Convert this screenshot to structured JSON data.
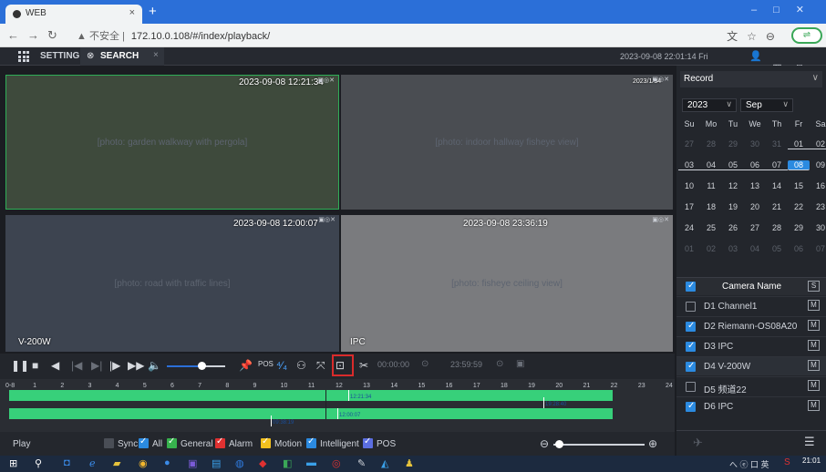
{
  "browser": {
    "tab_title": "WEB",
    "tab_close": "×",
    "new_tab": "+",
    "url_prefix": "▲ 不安全 |",
    "url": "172.10.0.108/#/index/playback/"
  },
  "app": {
    "setting_label": "SETTING",
    "search_label": "SEARCH",
    "tab_close": "×",
    "datetime": "2023-09-08 22:01:14 Fri"
  },
  "tiles": [
    {
      "timestamp": "2023-09-08 12:21:34",
      "label": "",
      "placeholder": "[photo: garden walkway with pergola]"
    },
    {
      "timestamp": "2023/1/34",
      "label": "",
      "placeholder": "[photo: indoor hallway fisheye view]"
    },
    {
      "timestamp": "2023-09-08 12:00:07",
      "label": "V-200W",
      "placeholder": "[photo: road with traffic lines]"
    },
    {
      "timestamp": "2023-09-08 23:36:19",
      "label": "IPC",
      "placeholder": "[photo: fisheye ceiling view]"
    }
  ],
  "toolbar": {
    "time_start": "00:00:00",
    "time_end": "23:59:59",
    "pos_label": "POS"
  },
  "timeline": {
    "ticks": [
      "0-8",
      "1",
      "2",
      "3",
      "4",
      "5",
      "6",
      "7",
      "8",
      "9",
      "10",
      "11",
      "12",
      "13",
      "14",
      "15",
      "16",
      "17",
      "18",
      "19",
      "20",
      "21",
      "22",
      "23",
      "24"
    ],
    "cursor_labels": [
      "12:21:34",
      "19:28:40",
      "12:00:07",
      "09:38:19"
    ]
  },
  "bottom": {
    "play_label": "Play",
    "filters": [
      {
        "label": "Sync",
        "checked": false,
        "color": "#4a4e56"
      },
      {
        "label": "All",
        "checked": true,
        "color": "#2b8ae0"
      },
      {
        "label": "General",
        "checked": true,
        "color": "#37b24d"
      },
      {
        "label": "Alarm",
        "checked": true,
        "color": "#e03131"
      },
      {
        "label": "Motion",
        "checked": true,
        "color": "#f2c01e"
      },
      {
        "label": "Intelligent",
        "checked": true,
        "color": "#2b8ae0"
      },
      {
        "label": "POS",
        "checked": true,
        "color": "#5b6ee1"
      }
    ]
  },
  "panel": {
    "record_type": "Record",
    "year": "2023",
    "month": "Sep",
    "weekdays": [
      "Su",
      "Mo",
      "Tu",
      "We",
      "Th",
      "Fr",
      "Sa"
    ],
    "weeks": [
      [
        "27",
        "28",
        "29",
        "30",
        "31",
        "01",
        "02"
      ],
      [
        "03",
        "04",
        "05",
        "06",
        "07",
        "08",
        "09"
      ],
      [
        "10",
        "11",
        "12",
        "13",
        "14",
        "15",
        "16"
      ],
      [
        "17",
        "18",
        "19",
        "20",
        "21",
        "22",
        "23"
      ],
      [
        "24",
        "25",
        "26",
        "27",
        "28",
        "29",
        "30"
      ],
      [
        "01",
        "02",
        "03",
        "04",
        "05",
        "06",
        "07"
      ]
    ],
    "camera_header": "Camera Name",
    "header_badge": "S",
    "cameras": [
      {
        "name": "D1 Channel1",
        "checked": false,
        "badge": "M"
      },
      {
        "name": "D2 Riemann-OS08A20",
        "checked": true,
        "badge": "M"
      },
      {
        "name": "D3 IPC",
        "checked": true,
        "badge": "M"
      },
      {
        "name": "D4 V-200W",
        "checked": true,
        "badge": "M"
      },
      {
        "name": "D5 频道22",
        "checked": false,
        "badge": "M"
      },
      {
        "name": "D6 IPC",
        "checked": true,
        "badge": "M"
      }
    ]
  },
  "taskbar": {
    "tray": "へ ⓔ 口 英",
    "time": "21:01"
  }
}
